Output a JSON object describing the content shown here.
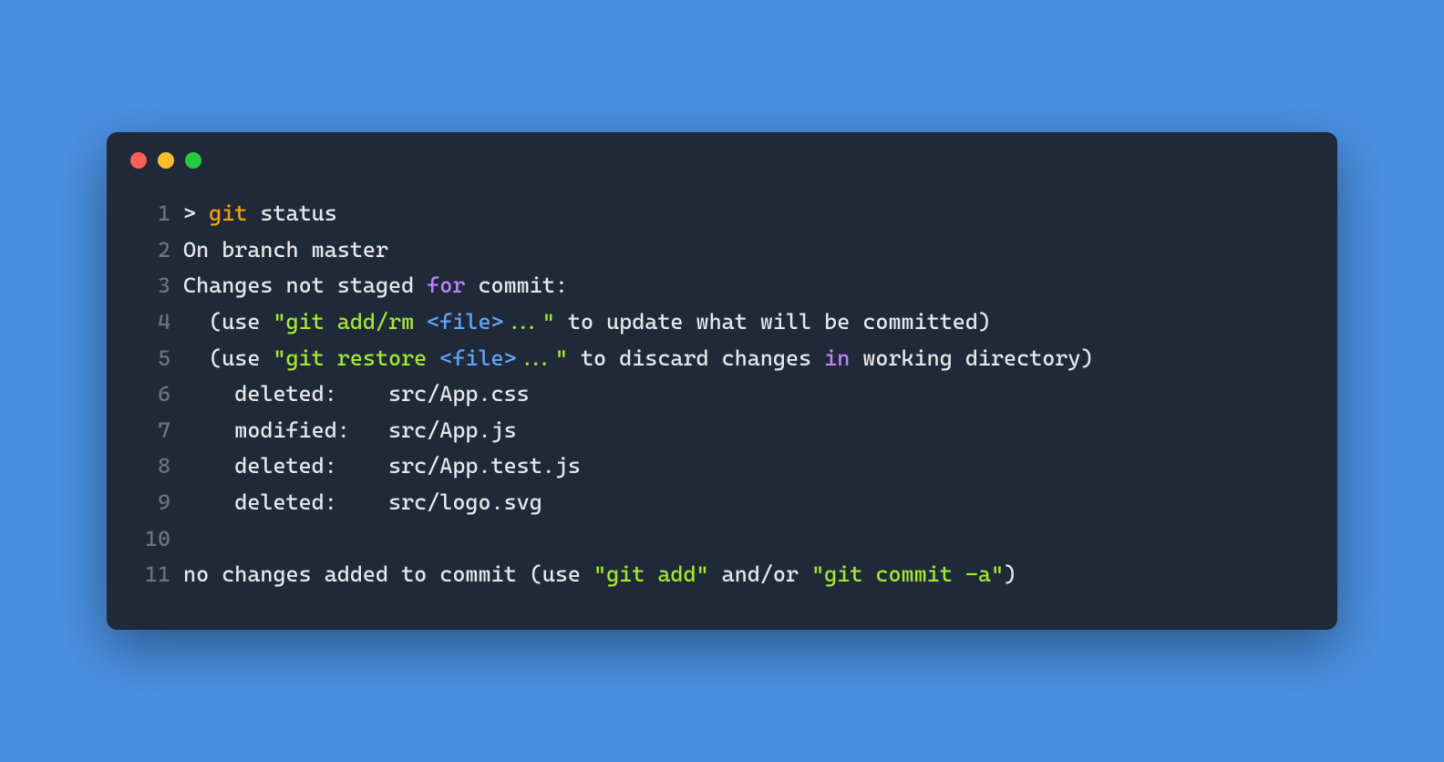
{
  "colors": {
    "page_bg": "#4a90e2",
    "terminal_bg": "#1f2937",
    "text": "#e5e7eb",
    "line_number": "#6b7280",
    "git_keyword": "#f59e0b",
    "control_keyword": "#c084fc",
    "string": "#a3e635",
    "tag": "#60a5fa",
    "close_red": "#ff5f56",
    "minimize_yellow": "#ffbd2e",
    "maximize_green": "#27c93f"
  },
  "window_controls": [
    "close",
    "minimize",
    "maximize"
  ],
  "lines": [
    {
      "n": "1",
      "parts": [
        {
          "t": "> ",
          "c": ""
        },
        {
          "t": "git",
          "c": "kw-git"
        },
        {
          "t": " status",
          "c": ""
        }
      ]
    },
    {
      "n": "2",
      "parts": [
        {
          "t": "On branch master",
          "c": ""
        }
      ]
    },
    {
      "n": "3",
      "parts": [
        {
          "t": "Changes not staged ",
          "c": ""
        },
        {
          "t": "for",
          "c": "kw-for"
        },
        {
          "t": " commit:",
          "c": ""
        }
      ]
    },
    {
      "n": "4",
      "parts": [
        {
          "t": "  (use ",
          "c": ""
        },
        {
          "t": "\"git add/rm ",
          "c": "str"
        },
        {
          "t": "<file>",
          "c": "tag"
        },
        {
          "t": "...\"",
          "c": "str"
        },
        {
          "t": " to update what will be committed)",
          "c": ""
        }
      ]
    },
    {
      "n": "5",
      "parts": [
        {
          "t": "  (use ",
          "c": ""
        },
        {
          "t": "\"git restore ",
          "c": "str"
        },
        {
          "t": "<file>",
          "c": "tag"
        },
        {
          "t": "...\"",
          "c": "str"
        },
        {
          "t": " to discard changes ",
          "c": ""
        },
        {
          "t": "in",
          "c": "kw-in"
        },
        {
          "t": " working directory)",
          "c": ""
        }
      ]
    },
    {
      "n": "6",
      "parts": [
        {
          "t": "    deleted:    src/App.css",
          "c": ""
        }
      ]
    },
    {
      "n": "7",
      "parts": [
        {
          "t": "    modified:   src/App.js",
          "c": ""
        }
      ]
    },
    {
      "n": "8",
      "parts": [
        {
          "t": "    deleted:    src/App.test.js",
          "c": ""
        }
      ]
    },
    {
      "n": "9",
      "parts": [
        {
          "t": "    deleted:    src/logo.svg",
          "c": ""
        }
      ]
    },
    {
      "n": "10",
      "parts": [
        {
          "t": "",
          "c": ""
        }
      ]
    },
    {
      "n": "11",
      "parts": [
        {
          "t": "no changes added to commit (use ",
          "c": ""
        },
        {
          "t": "\"git add\"",
          "c": "str"
        },
        {
          "t": " and/or ",
          "c": ""
        },
        {
          "t": "\"git commit -a\"",
          "c": "str"
        },
        {
          "t": ")",
          "c": ""
        }
      ]
    }
  ]
}
